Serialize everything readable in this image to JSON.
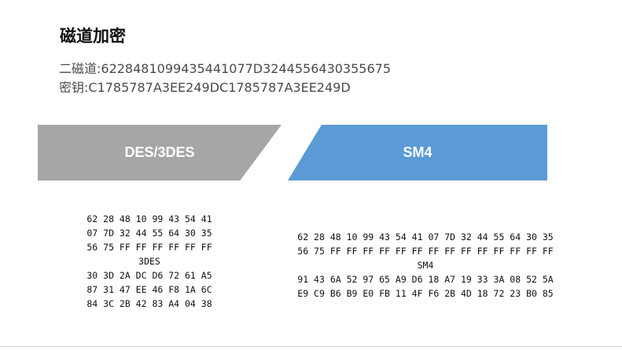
{
  "title": "磁道加密",
  "info": {
    "track2_line": "二磁道:6228481099435441077D3244556430355675",
    "key_line": "密钥:C1785787A3EE249DC1785787A3EE249D"
  },
  "tabs": {
    "des_label": "DES/3DES",
    "sm4_label": "SM4"
  },
  "des_block": {
    "lines": [
      "62 28 48 10 99 43 54 41",
      "07 7D 32 44 55 64 30 35",
      "56 75 FF FF FF FF FF FF",
      "3DES",
      "30 3D 2A DC D6 72 61 A5",
      "87 31 47 EE 46 F8 1A 6C",
      "84 3C 2B 42 83 A4 04 38"
    ]
  },
  "sm4_block": {
    "lines": [
      "62 28 48 10 99 43 54 41 07 7D 32 44 55 64 30 35",
      "56 75 FF FF FF FF FF FF FF FF FF FF FF FF FF FF",
      "SM4",
      "91 43 6A 52 97 65 A9 D6 18 A7 19 33 3A 08 52 5A",
      "E9 C9 B6 B9 E0 FB 11 4F F6 2B 4D 18 72 23 B0 85"
    ]
  },
  "colors": {
    "des_tab": "#a6a6a6",
    "sm4_tab": "#5b9bd5",
    "text": "#111111",
    "info_text": "#4a4a4a"
  }
}
